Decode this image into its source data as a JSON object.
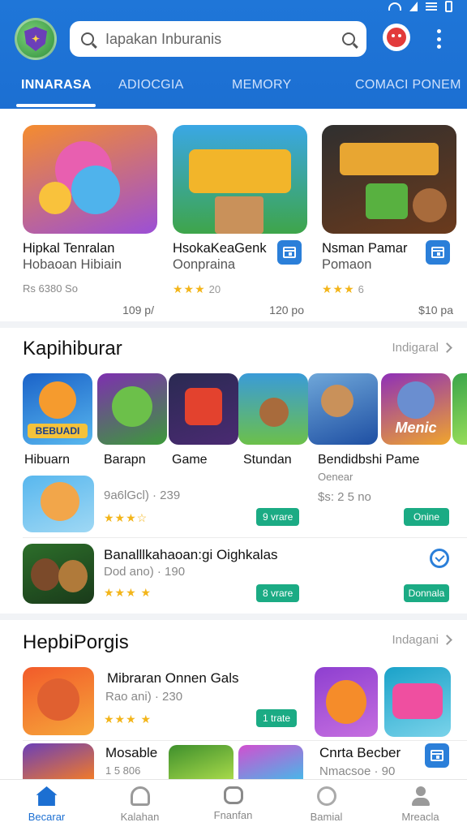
{
  "header": {
    "search_placeholder": "Iapakan Inburanis",
    "tabs": [
      {
        "label": "INNARASA",
        "active": true
      },
      {
        "label": "ADIOCGIA",
        "active": false
      },
      {
        "label": "MEMORY",
        "active": false
      },
      {
        "label": "COMACI PONEM",
        "active": false
      }
    ]
  },
  "featured": [
    {
      "title": "Hipkal Tenralan",
      "subtitle": "Hobaoan Hibiain",
      "meta": "Rs 6380 So",
      "stars": "",
      "count": "",
      "price": "109 p/",
      "thumb_colors": [
        "#f77f2b",
        "#9b4fd6"
      ]
    },
    {
      "title": "HsokaKeaGenk",
      "subtitle": "Oonpraina",
      "meta": "",
      "stars": "★★★",
      "count": "20",
      "price": "120 po",
      "thumb_colors": [
        "#3ea54a",
        "#1f8fd8"
      ]
    },
    {
      "title": "Nsman Pamar",
      "subtitle": "Pomaon",
      "meta": "",
      "stars": "★★★",
      "count": "6",
      "price": "$10 pa",
      "thumb_colors": [
        "#6b3a1c",
        "#2f2f2f"
      ]
    }
  ],
  "section1": {
    "title": "Kapihiburar",
    "more": "Indigaral",
    "icons": [
      {
        "label": "Hibuarn",
        "colors": [
          "#1b63c9",
          "#f59b2e"
        ],
        "text": "BEBUADI"
      },
      {
        "label": "Barapn",
        "colors": [
          "#7e2fb0",
          "#3c9a3a"
        ],
        "text": ""
      },
      {
        "label": "Game",
        "colors": [
          "#2a2a52",
          "#e3422e"
        ],
        "text": ""
      },
      {
        "label": "Stundan",
        "colors": [
          "#3a9bd8",
          "#6cc04a"
        ],
        "text": ""
      },
      {
        "label": "Bendidbshi Pame",
        "colors": [
          "#1e4fa3",
          "#6fa7d9"
        ],
        "text": ""
      },
      {
        "label": "",
        "colors": [
          "#8e2fb8",
          "#f0a52c"
        ],
        "text": "Menic"
      }
    ],
    "extra_sub": "Oenear",
    "extra_price": "$s: 2 5 no"
  },
  "list1": [
    {
      "title": "",
      "sub": "9a6lGcl) · 239",
      "stars": "★★★☆",
      "pill": "9 vrare",
      "colors": [
        "#58b7ee",
        "#f2a64a"
      ]
    },
    {
      "title": "Banalllkahaoan:gi Oighkalas",
      "sub": "Dod ano) · 190",
      "stars": "★★★ ★",
      "pill": "8 vrare",
      "colors": [
        "#2c6e2a",
        "#7b4a2a"
      ],
      "pill2": "Donnala"
    }
  ],
  "list1_pill_alt": "Onine",
  "section2": {
    "title": "HepbiPorgis",
    "more": "Indagani"
  },
  "list2": [
    {
      "title": "Mibraran Onnen Gals",
      "sub": "Rao ani) · 230",
      "stars": "★★★ ★",
      "pill": "1 trate",
      "colors": [
        "#f25b2a",
        "#f6a63a"
      ]
    },
    {
      "title": "Mosable",
      "sub": "1 5 806",
      "colors": [
        "#6a3fb8",
        "#f07a2a"
      ]
    }
  ],
  "section2_right": [
    {
      "colors": [
        "#8e3fd0",
        "#f58c2a"
      ]
    },
    {
      "colors": [
        "#1aa2c9",
        "#ef4fa0"
      ]
    }
  ],
  "bottom_card": {
    "title": "Cnrta Becber",
    "sub": "Nmacsoe · 90"
  },
  "bottom_thumbs": [
    {
      "colors": [
        "#3e8f2c",
        "#a7d94a"
      ]
    },
    {
      "colors": [
        "#d24fd0",
        "#49b6e8"
      ]
    }
  ],
  "nav": [
    {
      "label": "Becarar",
      "active": true
    },
    {
      "label": "Kalahan",
      "active": false
    },
    {
      "label": "Fnanfan",
      "active": false
    },
    {
      "label": "Bamial",
      "active": false
    },
    {
      "label": "Mreacla",
      "active": false
    }
  ]
}
